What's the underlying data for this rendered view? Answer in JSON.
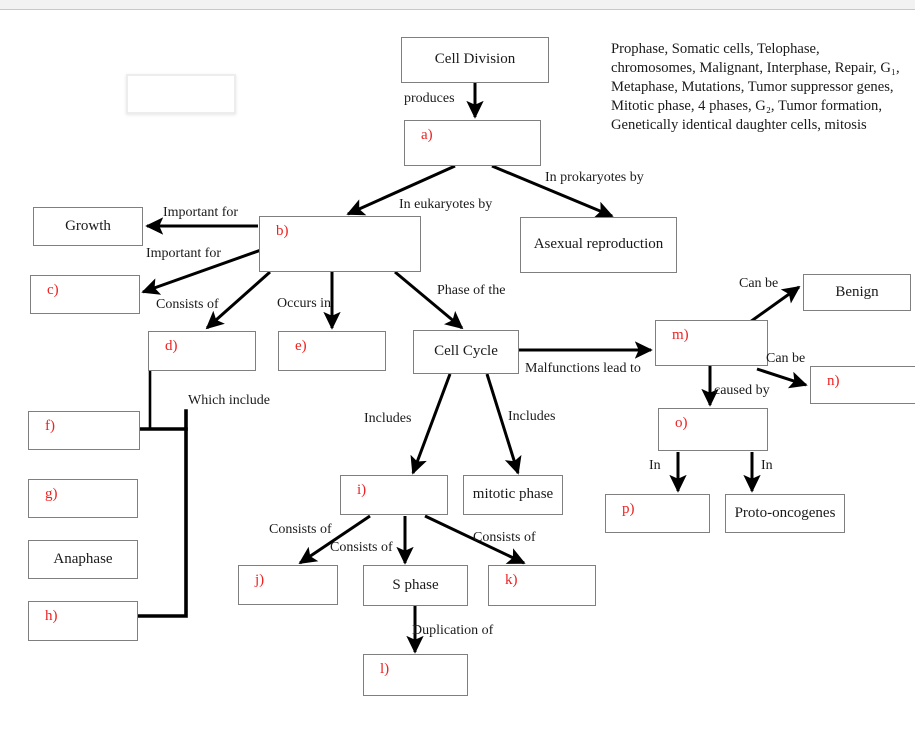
{
  "word_bank": {
    "text": "Prophase, Somatic cells, Telophase, chromosomes, Malignant, Interphase, Repair, G₁, Metaphase, Mutations, Tumor suppressor genes, Mitotic phase, 4 phases, G₂, Tumor formation, Genetically identical daughter cells, mitosis",
    "terms": [
      "Prophase",
      "Somatic cells",
      "Telophase",
      "chromosomes",
      "Malignant",
      "Interphase",
      "Repair",
      "G₁",
      "Metaphase",
      "Mutations",
      "Tumor suppressor genes",
      "Mitotic phase",
      "4 phases",
      "G₂",
      "Tumor formation",
      "Genetically identical daughter cells",
      "mitosis"
    ]
  },
  "colors": {
    "blank_letter": "#ee2222",
    "box_border": "#7f7f7f",
    "text": "#1a1a1a",
    "arrow": "#000000",
    "ghost_border": "#ededed"
  },
  "nodes": [
    {
      "id": "ghost",
      "label": ""
    },
    {
      "id": "cell-division",
      "label": "Cell Division"
    },
    {
      "id": "a",
      "label": "a)"
    },
    {
      "id": "asexual",
      "label": "Asexual reproduction"
    },
    {
      "id": "b",
      "label": "b)"
    },
    {
      "id": "growth",
      "label": "Growth"
    },
    {
      "id": "c",
      "label": "c)"
    },
    {
      "id": "d",
      "label": "d)"
    },
    {
      "id": "e",
      "label": "e)"
    },
    {
      "id": "cell-cycle",
      "label": "Cell Cycle"
    },
    {
      "id": "f",
      "label": "f)"
    },
    {
      "id": "g",
      "label": "g)"
    },
    {
      "id": "anaphase",
      "label": "Anaphase"
    },
    {
      "id": "h",
      "label": "h)"
    },
    {
      "id": "i",
      "label": "i)"
    },
    {
      "id": "mitotic-phase",
      "label": "mitotic phase"
    },
    {
      "id": "j",
      "label": "j)"
    },
    {
      "id": "s-phase",
      "label": "S phase"
    },
    {
      "id": "k",
      "label": "k)"
    },
    {
      "id": "l",
      "label": "l)"
    },
    {
      "id": "m",
      "label": "m)"
    },
    {
      "id": "benign",
      "label": "Benign"
    },
    {
      "id": "n",
      "label": "n)"
    },
    {
      "id": "o",
      "label": "o)"
    },
    {
      "id": "p",
      "label": "p)"
    },
    {
      "id": "proto-oncogenes",
      "label": "Proto-oncogenes"
    }
  ],
  "edge_labels": [
    {
      "id": "produces",
      "text": "produces"
    },
    {
      "id": "in-eukaryotes-by",
      "text": "In eukaryotes by"
    },
    {
      "id": "in-prokaryotes-by",
      "text": "In prokaryotes by"
    },
    {
      "id": "important-for-1",
      "text": "Important for"
    },
    {
      "id": "important-for-2",
      "text": "Important for"
    },
    {
      "id": "consists-of-b",
      "text": "Consists of"
    },
    {
      "id": "occurs-in",
      "text": "Occurs in"
    },
    {
      "id": "phase-of-the",
      "text": "Phase of the"
    },
    {
      "id": "which-include",
      "text": "Which include"
    },
    {
      "id": "includes-1",
      "text": "Includes"
    },
    {
      "id": "includes-2",
      "text": "Includes"
    },
    {
      "id": "malfunctions",
      "text": "Malfunctions lead to"
    },
    {
      "id": "consists-of-j",
      "text": "Consists of"
    },
    {
      "id": "consists-of-s",
      "text": "Consists of"
    },
    {
      "id": "consists-of-k",
      "text": "Consists of"
    },
    {
      "id": "duplication-of",
      "text": "Duplication of"
    },
    {
      "id": "can-be-1",
      "text": "Can be"
    },
    {
      "id": "can-be-2",
      "text": "Can be"
    },
    {
      "id": "caused-by",
      "text": "caused by"
    },
    {
      "id": "in-1",
      "text": "In"
    },
    {
      "id": "in-2",
      "text": "In"
    }
  ]
}
